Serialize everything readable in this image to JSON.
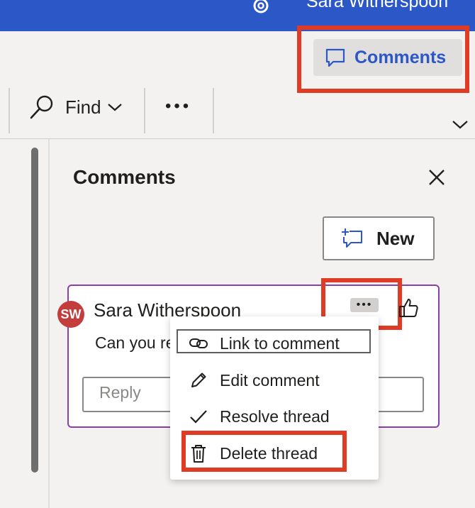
{
  "header": {
    "user_name": "Sara Witherspoon"
  },
  "ribbon": {
    "comments_button": "Comments",
    "find_label": "Find",
    "more_label": "•••"
  },
  "panel": {
    "title": "Comments",
    "new_button": "New",
    "comment": {
      "avatar_initials": "SW",
      "author": "Sara Witherspoon",
      "text": "Can you re",
      "reply_placeholder": "Reply",
      "more_label": "•••"
    }
  },
  "menu": {
    "items": [
      {
        "label": "Link to comment",
        "icon": "link-icon"
      },
      {
        "label": "Edit comment",
        "icon": "pencil-icon"
      },
      {
        "label": "Resolve thread",
        "icon": "checkmark-icon"
      },
      {
        "label": "Delete thread",
        "icon": "trash-icon"
      }
    ]
  },
  "colors": {
    "brand": "#2b57c7",
    "highlight": "#e03c25",
    "card_border": "#8b3fa8",
    "avatar": "#c43d3d"
  }
}
